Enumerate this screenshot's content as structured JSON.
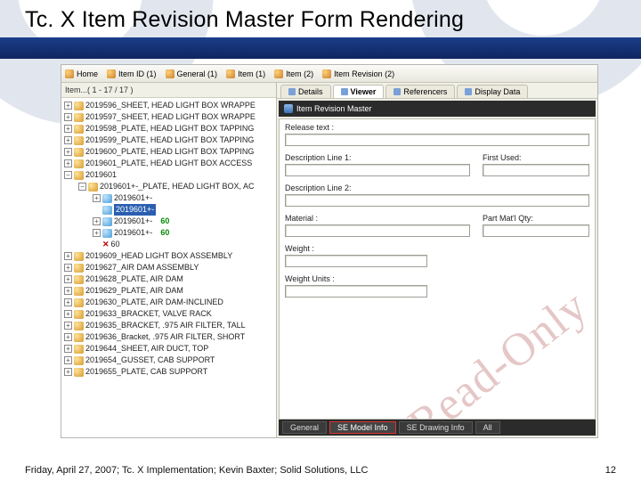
{
  "slide": {
    "title": "Tc. X Item Revision Master Form Rendering",
    "footer": "Friday, April 27, 2007; Tc. X Implementation; Kevin Baxter; Solid Solutions, LLC",
    "page": "12"
  },
  "toolbar": {
    "items": [
      "Home",
      "Item ID (1)",
      "General (1)",
      "Item (1)",
      "Item (2)",
      "Item Revision (2)"
    ]
  },
  "tree": {
    "header": "Item...( 1 - 17 / 17 )",
    "top": [
      "2019596_SHEET, HEAD LIGHT BOX  WRAPPE",
      "2019597_SHEET, HEAD LIGHT BOX  WRAPPE",
      "2019598_PLATE, HEAD LIGHT BOX  TAPPING",
      "2019599_PLATE, HEAD LIGHT BOX  TAPPING",
      "2019600_PLATE, HEAD LIGHT BOX  TAPPING",
      "2019601_PLATE, HEAD LIGHT BOX  ACCESS"
    ],
    "open_item": "2019601",
    "open_rev": "2019601+-_PLATE, HEAD LIGHT BOX, AC",
    "kids": [
      "2019601+-",
      "2019601+-",
      "2019601+-",
      "2019601+-"
    ],
    "sixty_pair": [
      "60",
      "60"
    ],
    "x60": "60",
    "bottom": [
      "2019609_HEAD LIGHT BOX ASSEMBLY",
      "2019627_AIR DAM ASSEMBLY",
      "2019628_PLATE, AIR DAM",
      "2019629_PLATE, AIR DAM",
      "2019630_PLATE, AIR DAM-INCLINED",
      "2019633_BRACKET, VALVE RACK",
      "2019635_BRACKET, .975 AIR FILTER, TALL",
      "2019636_Bracket, .975 AIR FILTER, SHORT",
      "2019644_SHEET, AIR DUCT, TOP",
      "2019654_GUSSET, CAB SUPPORT",
      "2019655_PLATE, CAB SUPPORT"
    ]
  },
  "right_tabs": [
    "Details",
    "Viewer",
    "Referencers",
    "Display Data"
  ],
  "form": {
    "title": "Item Revision Master",
    "fields": {
      "release": "Release text :",
      "desc1": "Description Line 1:",
      "first_used": "First Used:",
      "desc2": "Description Line 2:",
      "material": "Material :",
      "part_qty": "Part Mat'l Qty:",
      "weight": "Weight :",
      "weight_units": "Weight Units :"
    },
    "watermark": "Read-Only"
  },
  "bottom_tabs": [
    "General",
    "SE Model Info",
    "SE Drawing Info",
    "All"
  ]
}
